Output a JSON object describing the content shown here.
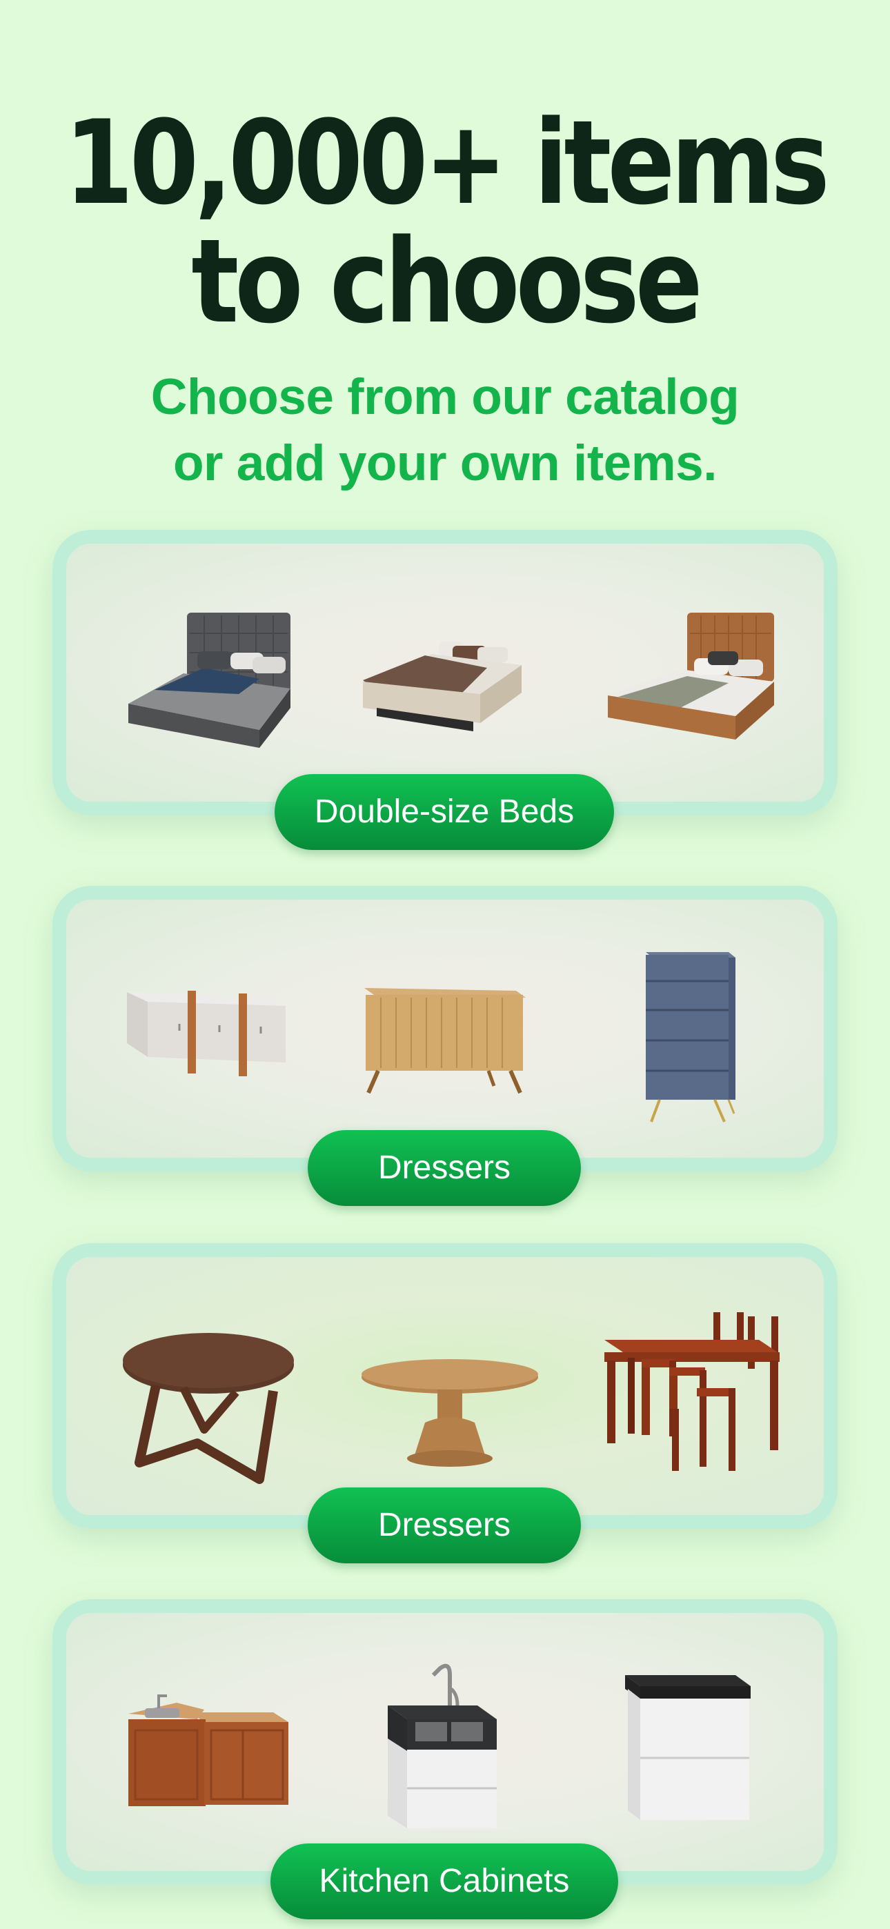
{
  "header": {
    "title_line1": "10,000+ items",
    "title_line2": "to choose",
    "subtitle_line1": "Choose from our catalog",
    "subtitle_line2": "or add your own items."
  },
  "categories": [
    {
      "label": "Double-size Beds",
      "items": [
        "tufted-gray-bed",
        "brown-duvet-platform-bed",
        "tan-upholstered-bed"
      ]
    },
    {
      "label": "Dressers",
      "items": [
        "white-sideboard",
        "oak-sideboard",
        "blue-tall-dresser"
      ]
    },
    {
      "label": "Dressers",
      "items": [
        "round-walnut-table",
        "pedestal-oval-table",
        "dining-set"
      ]
    },
    {
      "label": "Kitchen Cabinets",
      "items": [
        "corner-sink-cabinet",
        "black-top-sink-cabinet",
        "white-base-cabinet"
      ]
    }
  ],
  "colors": {
    "background": "#e0fbd9",
    "headline": "#0d2617",
    "subtitle": "#12b44b",
    "pill": "#0aa646",
    "card_border": "#bfeed8"
  }
}
